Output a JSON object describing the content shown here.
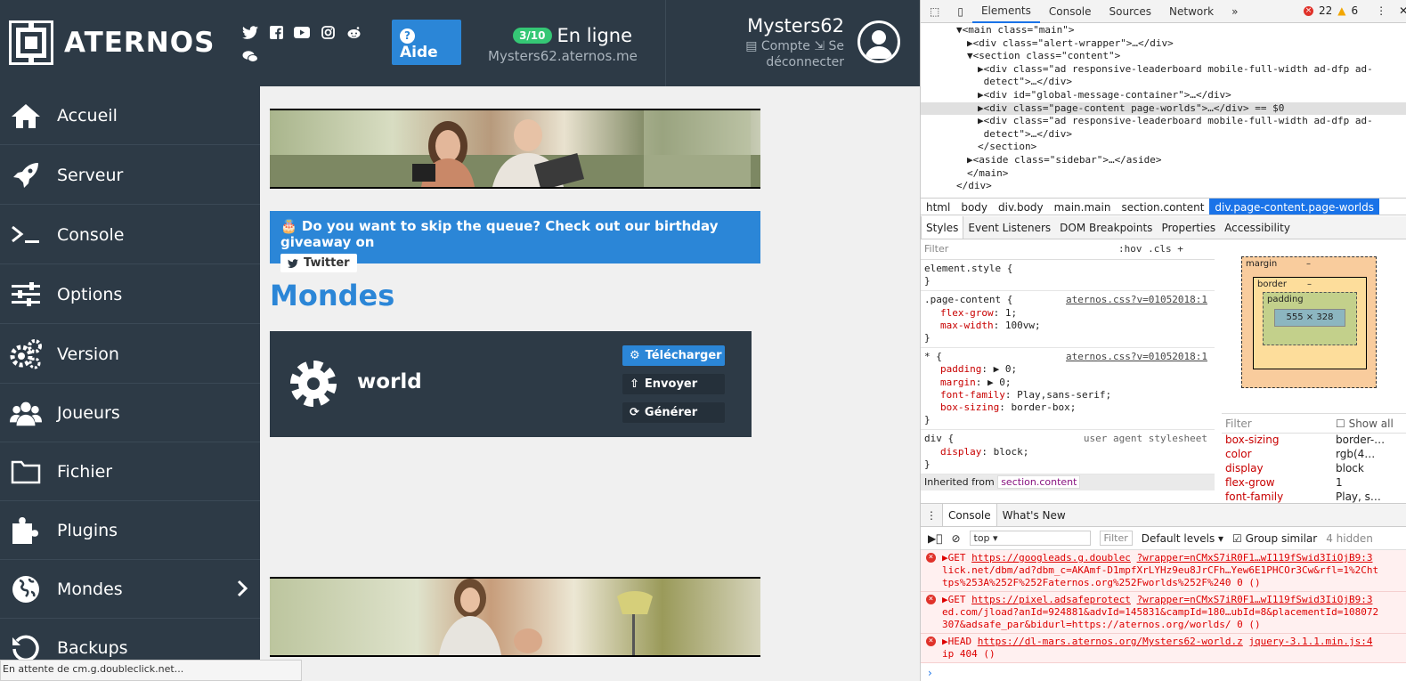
{
  "site": {
    "logo_text": "ATERNOS",
    "help_label": "Aide",
    "status_badge": "3/10",
    "status_text": "En ligne",
    "server_address": "Mysters62.aternos.me",
    "username": "Mysters62",
    "account_link": "Compte",
    "logout_link": "Se déconnecter",
    "nav": [
      {
        "label": "Accueil"
      },
      {
        "label": "Serveur"
      },
      {
        "label": "Console"
      },
      {
        "label": "Options"
      },
      {
        "label": "Version"
      },
      {
        "label": "Joueurs"
      },
      {
        "label": "Fichier"
      },
      {
        "label": "Plugins"
      },
      {
        "label": "Mondes"
      },
      {
        "label": "Backups"
      }
    ],
    "banner_text": "Do you want to skip the queue? Check out our birthday giveaway on",
    "banner_button": "Twitter",
    "page_title": "Mondes",
    "world_name": "world",
    "world_buttons": {
      "download": "Télécharger",
      "upload": "Envoyer",
      "generate": "Générer"
    },
    "browser_status": "En attente de cm.g.doubleclick.net..."
  },
  "devtools": {
    "tabs": [
      "Elements",
      "Console",
      "Sources",
      "Network"
    ],
    "active_tab": "Elements",
    "error_count": "22",
    "warning_count": "6",
    "dom_lines": [
      {
        "indent": 3,
        "text": "▼<main class=\"main\">"
      },
      {
        "indent": 4,
        "text": "▶<div class=\"alert-wrapper\">…</div>"
      },
      {
        "indent": 4,
        "text": "▼<section class=\"content\">"
      },
      {
        "indent": 5,
        "text": "▶<div class=\"ad responsive-leaderboard mobile-full-width ad-dfp ad-"
      },
      {
        "indent": 5,
        "text": " detect\">…</div>"
      },
      {
        "indent": 5,
        "text": "▶<div id=\"global-message-container\">…</div>"
      },
      {
        "indent": 5,
        "text": "▶<div class=\"page-content page-worlds\">…</div> == $0",
        "selected": true
      },
      {
        "indent": 5,
        "text": "▶<div class=\"ad responsive-leaderboard mobile-full-width ad-dfp ad-"
      },
      {
        "indent": 5,
        "text": " detect\">…</div>"
      },
      {
        "indent": 5,
        "text": "</section>"
      },
      {
        "indent": 4,
        "text": "▶<aside class=\"sidebar\">…</aside>"
      },
      {
        "indent": 4,
        "text": "</main>"
      },
      {
        "indent": 3,
        "text": "</div>"
      }
    ],
    "breadcrumbs": [
      "html",
      "body",
      "div.body",
      "main.main",
      "section.content",
      "div.page-content.page-worlds"
    ],
    "sub_tabs": [
      "Styles",
      "Event Listeners",
      "DOM Breakpoints",
      "Properties",
      "Accessibility"
    ],
    "styles_filter": "Filter",
    "styles_filter_right": ":hov  .cls  +",
    "rules": [
      {
        "selector": "element.style {",
        "source": "",
        "props": [],
        "close": "}"
      },
      {
        "selector": ".page-content {",
        "source": "aternos.css?v=01052018:1",
        "props": [
          [
            "flex-grow",
            "1;"
          ],
          [
            "max-width",
            "100vw;"
          ]
        ],
        "close": "}"
      },
      {
        "selector": "* {",
        "source": "aternos.css?v=01052018:1",
        "props": [
          [
            "padding",
            "▶ 0;"
          ],
          [
            "margin",
            "▶ 0;"
          ],
          [
            "font-family",
            "Play,sans-serif;"
          ],
          [
            "box-sizing",
            "border-box;"
          ]
        ],
        "close": "}"
      },
      {
        "selector": "div {",
        "source": "user agent stylesheet",
        "props": [
          [
            "display",
            "block;"
          ]
        ],
        "close": "}"
      }
    ],
    "inherited_label": "Inherited from",
    "inherited_from": "section.content",
    "box_model": {
      "margin": "margin",
      "border": "border",
      "padding": "padding",
      "dash": "–",
      "content": "555 × 328"
    },
    "computed_filter": "Filter",
    "show_all": "Show all",
    "computed": [
      [
        "box-sizing",
        "border-…"
      ],
      [
        "color",
        "rgb(4…"
      ],
      [
        "display",
        "block"
      ],
      [
        "flex-grow",
        "1"
      ],
      [
        "font-family",
        "Play, s…"
      ]
    ],
    "drawer_tabs": [
      "Console",
      "What's New"
    ],
    "console_context": "top",
    "console_filter": "Filter",
    "console_levels": "Default levels",
    "group_similar": "Group similar",
    "hidden_count": "4 hidden",
    "errors": [
      {
        "method": "GET",
        "url": "https://googleads.g.doublec",
        "url2": "?wrapper=nCMxS7iR0F1…wI119fSwid3IiOjB9:3",
        "rest": "lick.net/dbm/ad?dbm_c=AKAmf-D1mpfXrLYHz9eu8JrCFh…Yew6E1PHCOr3Cw&rfl=1%2Cht tps%253A%252F%252Faternos.org%252Fworlds%252F%240 0 ()"
      },
      {
        "method": "GET",
        "url": "https://pixel.adsafeprotect",
        "url2": "?wrapper=nCMxS7iR0F1…wI119fSwid3IiOjB9:3",
        "rest": "ed.com/jload?anId=924881&advId=145831&campId=180…ubId=8&placementId=108072 307&adsafe_par&bidurl=https://aternos.org/worlds/ 0 ()"
      },
      {
        "method": "HEAD",
        "url": "https://dl-mars.aternos.org/Mysters62-world.z",
        "url2": "jquery-3.1.1.min.js:4",
        "rest": "ip 404 ()"
      }
    ]
  }
}
